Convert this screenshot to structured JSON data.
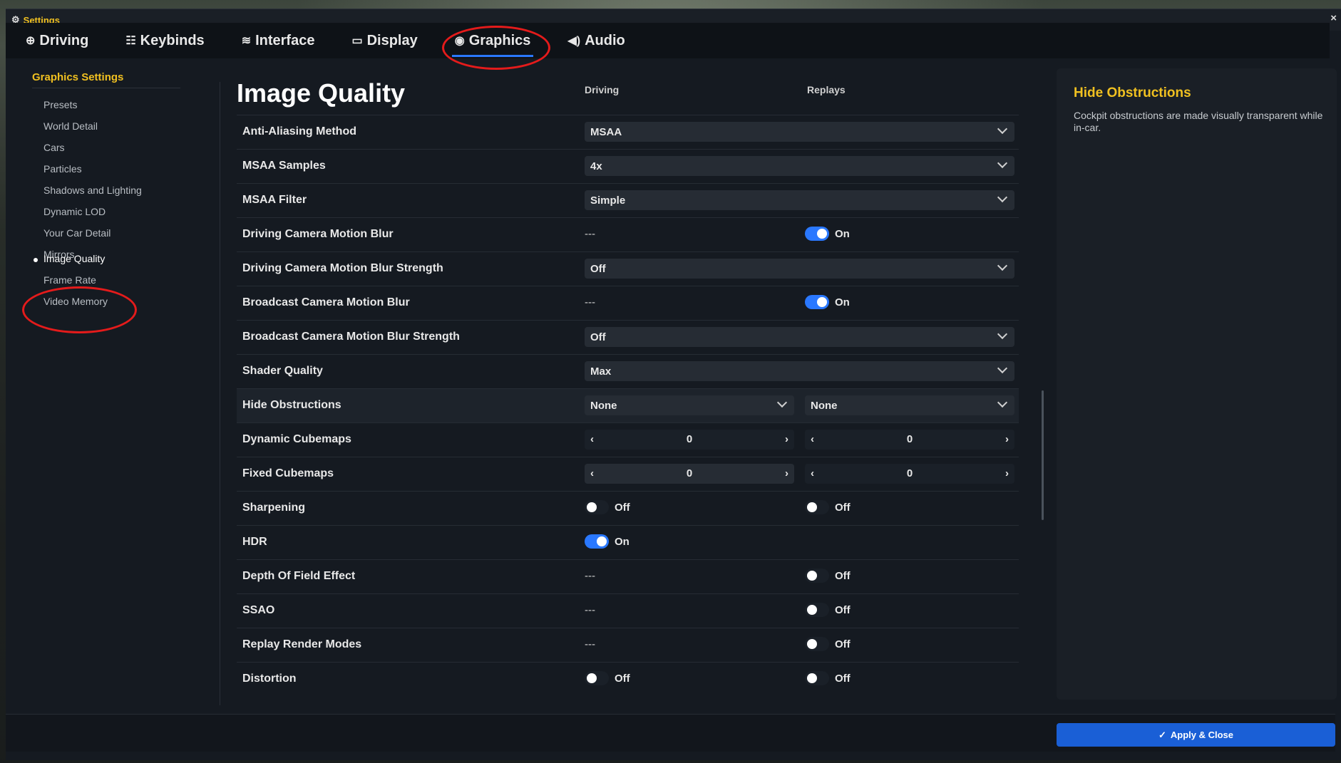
{
  "window": {
    "title": "Settings",
    "close_glyph": "×"
  },
  "tabs": [
    {
      "label": "Driving",
      "icon": "⊕"
    },
    {
      "label": "Keybinds",
      "icon": "☷"
    },
    {
      "label": "Interface",
      "icon": "≋"
    },
    {
      "label": "Display",
      "icon": "▭"
    },
    {
      "label": "Graphics",
      "icon": "◉"
    },
    {
      "label": "Audio",
      "icon": "◀)"
    }
  ],
  "sidebar": {
    "heading": "Graphics Settings",
    "items": [
      "Presets",
      "World Detail",
      "Cars",
      "Particles",
      "Shadows and Lighting",
      "Dynamic LOD",
      "Your Car Detail",
      "Mirrors",
      "Image Quality",
      "Frame Rate",
      "Video Memory"
    ]
  },
  "main": {
    "title": "Image Quality",
    "col_driving": "Driving",
    "col_replays": "Replays",
    "rows": {
      "aa": {
        "label": "Anti-Aliasing Method",
        "value": "MSAA"
      },
      "msaa_samples": {
        "label": "MSAA Samples",
        "value": "4x"
      },
      "msaa_filter": {
        "label": "MSAA Filter",
        "value": "Simple"
      },
      "dcmb": {
        "label": "Driving Camera Motion Blur",
        "driving": "---",
        "replays": "On"
      },
      "dcmbs": {
        "label": "Driving Camera Motion Blur Strength",
        "value": "Off"
      },
      "bcmb": {
        "label": "Broadcast Camera Motion Blur",
        "driving": "---",
        "replays": "On"
      },
      "bcmbs": {
        "label": "Broadcast Camera Motion Blur Strength",
        "value": "Off"
      },
      "shader": {
        "label": "Shader Quality",
        "value": "Max"
      },
      "hide": {
        "label": "Hide Obstructions",
        "driving": "None",
        "replays": "None"
      },
      "dyn_cube": {
        "label": "Dynamic Cubemaps",
        "driving": "0",
        "replays": "0"
      },
      "fixed_cube": {
        "label": "Fixed Cubemaps",
        "driving": "0",
        "replays": "0"
      },
      "sharpen": {
        "label": "Sharpening",
        "driving": "Off",
        "replays": "Off"
      },
      "hdr": {
        "label": "HDR",
        "driving": "On"
      },
      "dof": {
        "label": "Depth Of Field Effect",
        "driving": "---",
        "replays": "Off"
      },
      "ssao": {
        "label": "SSAO",
        "driving": "---",
        "replays": "Off"
      },
      "replay_render": {
        "label": "Replay Render Modes",
        "driving": "---",
        "replays": "Off"
      },
      "distortion": {
        "label": "Distortion",
        "driving": "Off",
        "replays": "Off"
      }
    }
  },
  "info": {
    "title": "Hide Obstructions",
    "text": "Cockpit obstructions are made visually transparent while in-car."
  },
  "footer": {
    "apply_label": "Apply & Close",
    "apply_icon": "✓"
  },
  "colors": {
    "accent_blue": "#2a78ff",
    "heading_yellow": "#f0c020",
    "annotation_red": "#e41b1b"
  }
}
